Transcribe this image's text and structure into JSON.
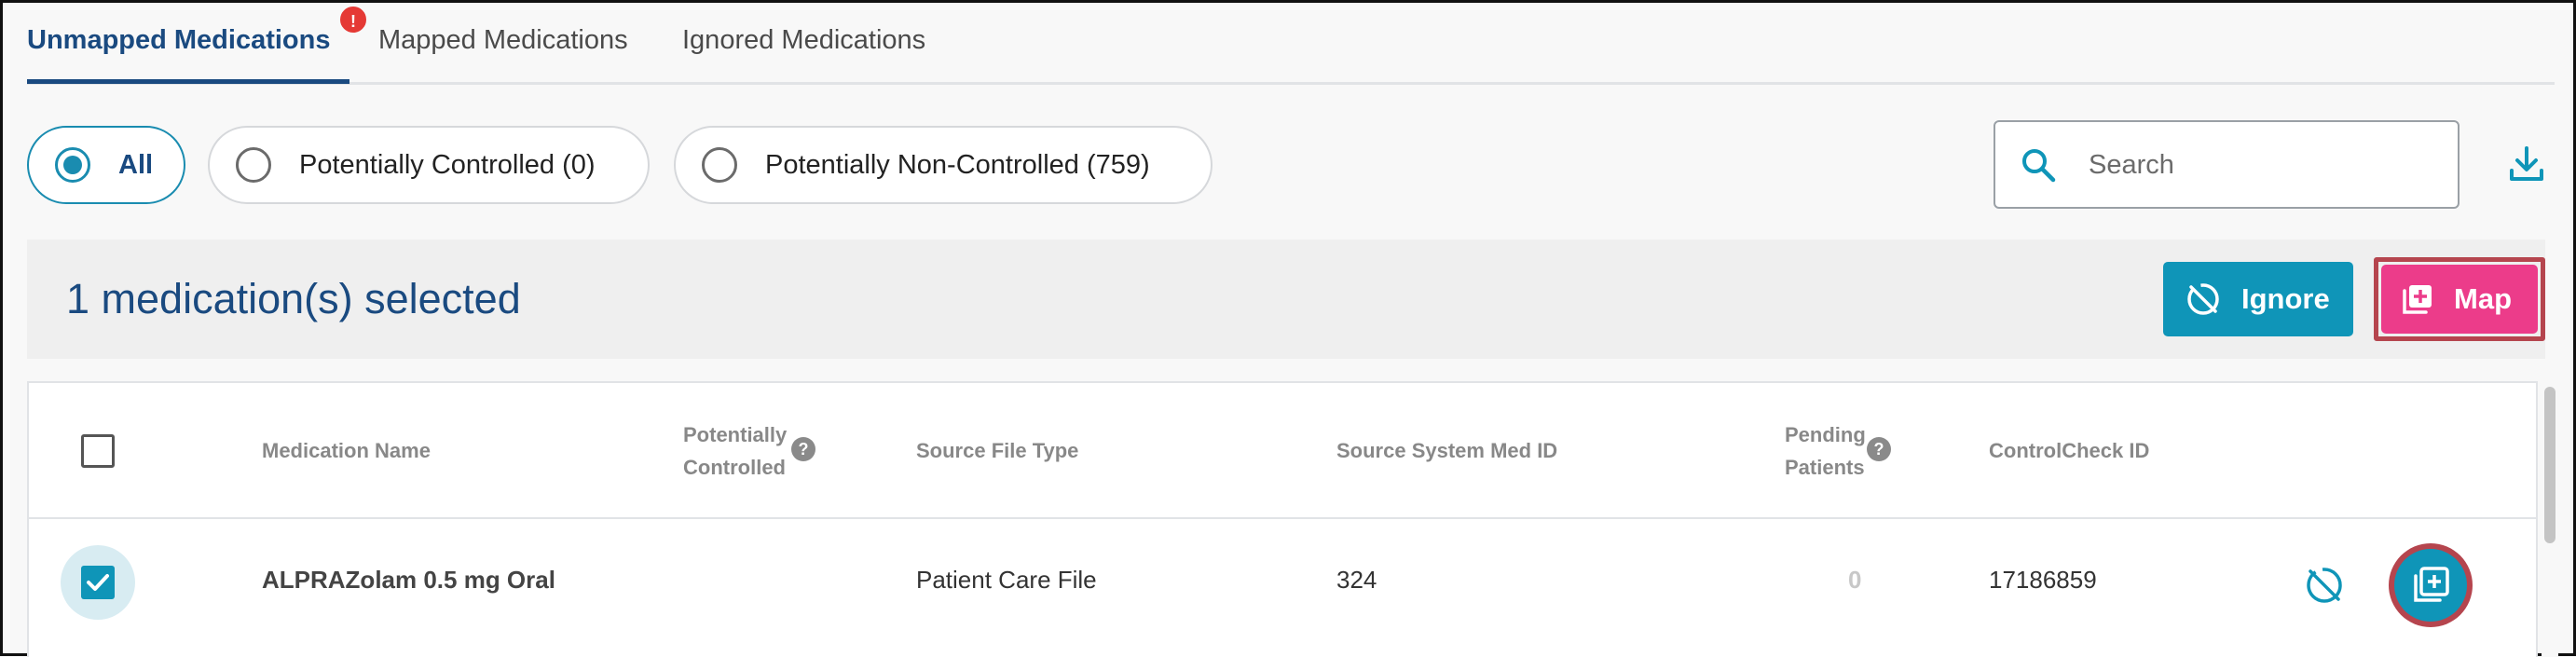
{
  "tabs": [
    {
      "label": "Unmapped Medications",
      "active": true,
      "alert": "!"
    },
    {
      "label": "Mapped Medications",
      "active": false
    },
    {
      "label": "Ignored Medications",
      "active": false
    }
  ],
  "filters": [
    {
      "label": "All",
      "selected": true
    },
    {
      "label": "Potentially Controlled (0)",
      "selected": false
    },
    {
      "label": "Potentially Non-Controlled (759)",
      "selected": false
    }
  ],
  "search": {
    "placeholder": "Search",
    "value": ""
  },
  "selection_bar": {
    "text": "1 medication(s) selected",
    "ignore_label": "Ignore",
    "map_label": "Map"
  },
  "table": {
    "headers": {
      "medication_name": "Medication Name",
      "potentially_controlled_1": "Potentially",
      "potentially_controlled_2": "Controlled",
      "source_file_type": "Source File Type",
      "source_system_med_id": "Source System Med ID",
      "pending_patients_1": "Pending",
      "pending_patients_2": "Patients",
      "controlcheck_id": "ControlCheck ID"
    },
    "rows": [
      {
        "checked": true,
        "medication_name": "ALPRAZolam 0.5 mg Oral",
        "potentially_controlled": "",
        "source_file_type": "Patient Care File",
        "source_system_med_id": "324",
        "pending_patients": "0",
        "controlcheck_id": "17186859"
      }
    ]
  },
  "colors": {
    "primary": "#0f95b8",
    "navy": "#1a4a80",
    "map_pink": "#ec3c8a",
    "highlight_outline": "#b5454e",
    "alert_red": "#e53935"
  }
}
